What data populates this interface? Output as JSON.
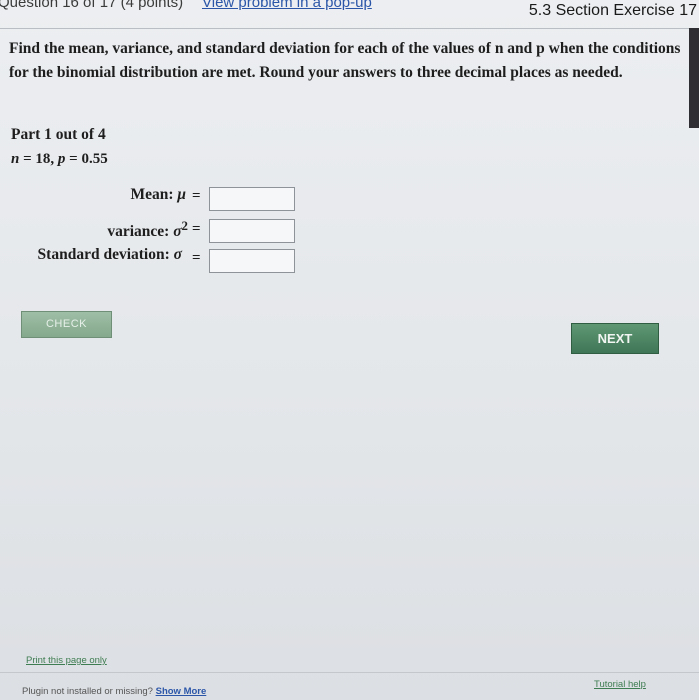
{
  "topbar": {
    "question_meta": "Question 16 of 17 (4 points)",
    "popup_link": "View problem in a pop-up",
    "exercise": "5.3 Section Exercise 17"
  },
  "instructions": "Find the mean, variance, and standard deviation for each of the values of n and p when the conditions for the binomial distribution are met. Round your answers to three decimal places as needed.",
  "part": "Part 1 out of 4",
  "params": {
    "n_label": "n",
    "n_value": "= 18,",
    "p_label": "p",
    "p_value": "= 0.55"
  },
  "fields": [
    {
      "label": "Mean:",
      "symbol": "μ",
      "sup": "",
      "eq": "=",
      "value": ""
    },
    {
      "label": "variance:",
      "symbol": "σ",
      "sup": "2",
      "eq": "=",
      "value": ""
    },
    {
      "label": "Standard deviation:",
      "symbol": "σ",
      "sup": "",
      "eq": "=",
      "value": ""
    }
  ],
  "buttons": {
    "check": "CHECK",
    "next": "NEXT"
  },
  "footer": {
    "print": "Print this page only",
    "tutorial": "Tutorial help",
    "plugin_text": "Plugin not installed or missing?",
    "show_more": "Show More"
  }
}
